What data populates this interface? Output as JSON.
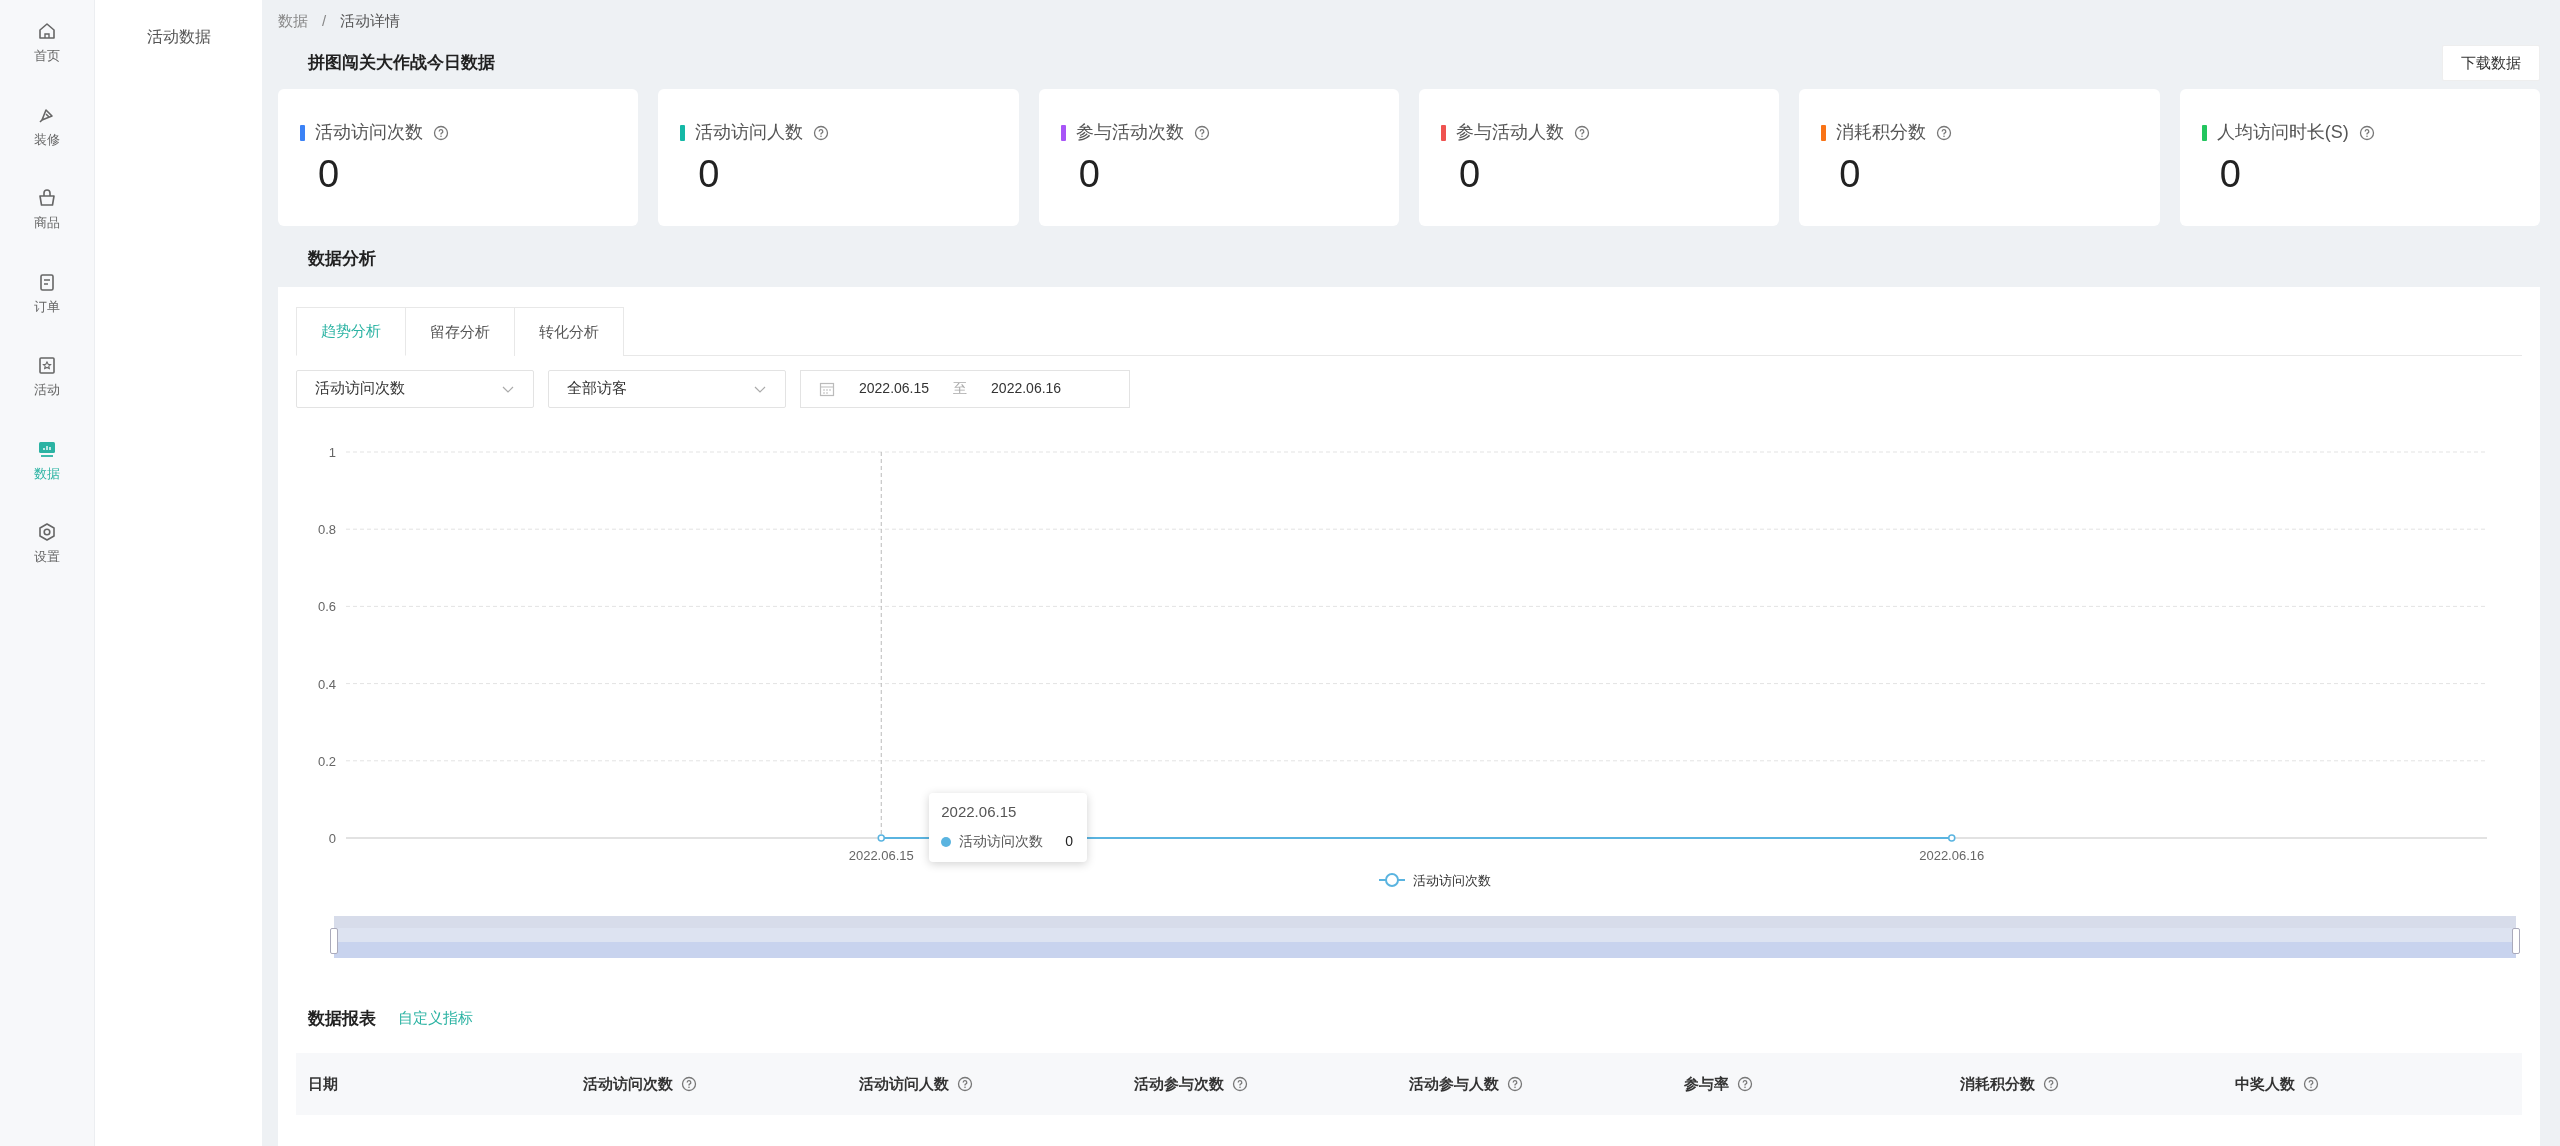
{
  "nav_rail": {
    "items": [
      {
        "label": "首页",
        "selected": false
      },
      {
        "label": "装修",
        "selected": false
      },
      {
        "label": "商品",
        "selected": false
      },
      {
        "label": "订单",
        "selected": false
      },
      {
        "label": "活动",
        "selected": false
      },
      {
        "label": "数据",
        "selected": true
      },
      {
        "label": "设置",
        "selected": false
      }
    ]
  },
  "sub_menu": {
    "items": [
      {
        "label": "活动数据"
      }
    ]
  },
  "breadcrumb": {
    "items": [
      "数据",
      "活动详情"
    ],
    "separator": "/"
  },
  "page_title": "拼图闯关大作战今日数据",
  "download_button": "下载数据",
  "stats": [
    {
      "label": "活动访问次数",
      "value": "0",
      "color": "#3b82f6"
    },
    {
      "label": "活动访问人数",
      "value": "0",
      "color": "#14b8a6"
    },
    {
      "label": "参与活动次数",
      "value": "0",
      "color": "#a855f7"
    },
    {
      "label": "参与活动人数",
      "value": "0",
      "color": "#ef5350"
    },
    {
      "label": "消耗积分数",
      "value": "0",
      "color": "#f97316"
    },
    {
      "label": "人均访问时长(S)",
      "value": "0",
      "color": "#22c55e"
    }
  ],
  "analysis": {
    "title": "数据分析",
    "tabs": [
      {
        "label": "趋势分析",
        "selected": true
      },
      {
        "label": "留存分析",
        "selected": false
      },
      {
        "label": "转化分析",
        "selected": false
      }
    ],
    "filters": {
      "metric": "活动访问次数",
      "audience": "全部访客",
      "date_start": "2022.06.15",
      "date_separator": "至",
      "date_end": "2022.06.16"
    },
    "chart_data": {
      "type": "line",
      "categories": [
        "2022.06.15",
        "2022.06.16"
      ],
      "series": [
        {
          "name": "活动访问次数",
          "color": "#5ab4e0",
          "marker": true,
          "values": [
            0,
            0
          ]
        }
      ],
      "ylim": [
        0,
        1
      ],
      "yticks": [
        0,
        0.2,
        0.4,
        0.6,
        0.8,
        1
      ],
      "grid": true,
      "ref_lines": [
        {
          "axis": "x",
          "value": "2022.06.15",
          "color": "#bbbbbb"
        }
      ]
    },
    "range_slider": {
      "level": 1
    },
    "tooltip": {
      "title": "2022.06.15",
      "series_name": "活动访问次数",
      "value": "0"
    }
  },
  "report": {
    "title": "数据报表",
    "link": "自定义指标",
    "columns": [
      {
        "label": "日期",
        "help": false
      },
      {
        "label": "活动访问次数",
        "help": true
      },
      {
        "label": "活动访问人数",
        "help": true
      },
      {
        "label": "活动参与次数",
        "help": true
      },
      {
        "label": "活动参与人数",
        "help": true
      },
      {
        "label": "参与率",
        "help": true
      },
      {
        "label": "消耗积分数",
        "help": true
      },
      {
        "label": "中奖人数",
        "help": true
      }
    ]
  }
}
